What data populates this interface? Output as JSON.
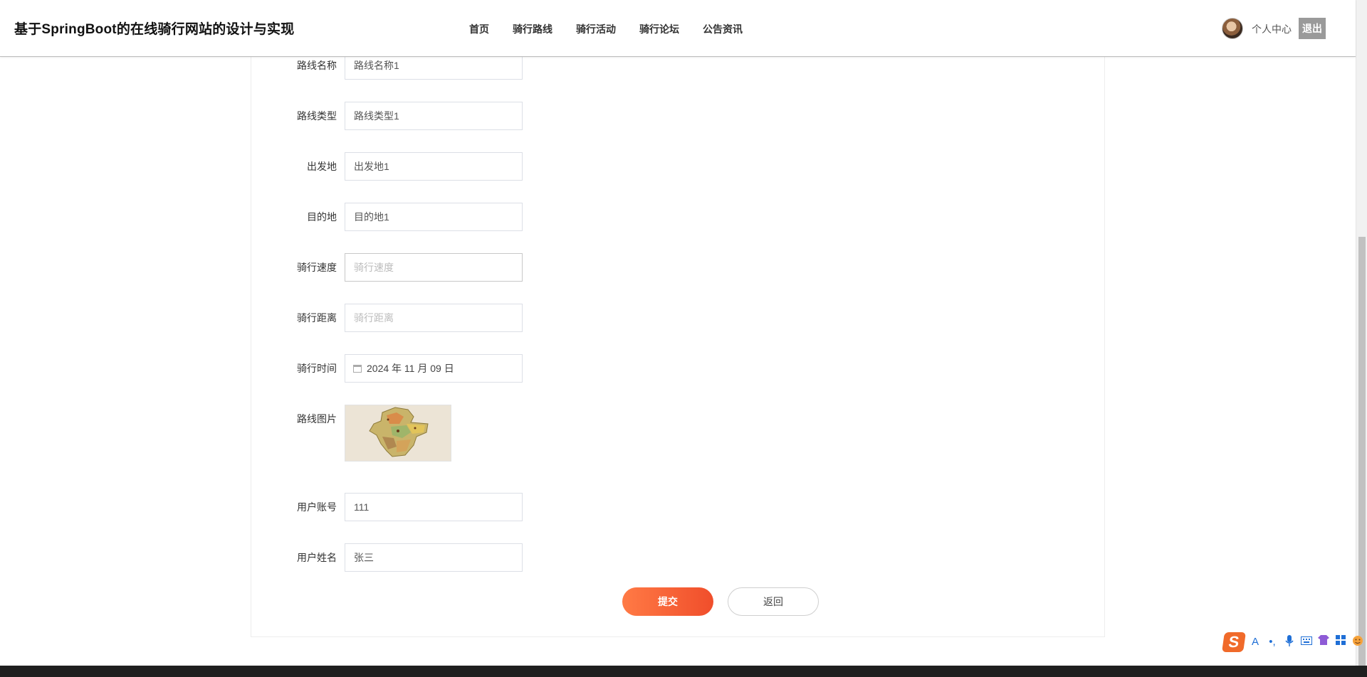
{
  "header": {
    "site_title": "基于SpringBoot的在线骑行网站的设计与实现",
    "nav": [
      {
        "label": "首页"
      },
      {
        "label": "骑行路线"
      },
      {
        "label": "骑行活动"
      },
      {
        "label": "骑行论坛"
      },
      {
        "label": "公告资讯"
      }
    ],
    "profile_label": "个人中心",
    "logout_label": "退出"
  },
  "form": {
    "route_name": {
      "label": "路线名称",
      "value": "路线名称1"
    },
    "route_type": {
      "label": "路线类型",
      "value": "路线类型1"
    },
    "departure": {
      "label": "出发地",
      "value": "出发地1"
    },
    "destination": {
      "label": "目的地",
      "value": "目的地1"
    },
    "speed": {
      "label": "骑行速度",
      "value": "",
      "placeholder": "骑行速度"
    },
    "distance": {
      "label": "骑行距离",
      "value": "",
      "placeholder": "骑行距离"
    },
    "ride_time": {
      "label": "骑行时间",
      "value": "2024 年 11 月 09 日"
    },
    "route_image": {
      "label": "路线图片"
    },
    "user_account": {
      "label": "用户账号",
      "value": "111"
    },
    "user_name": {
      "label": "用户姓名",
      "value": "张三"
    },
    "submit_label": "提交",
    "back_label": "返回"
  },
  "ime": {
    "logo": "S",
    "icons": [
      "letter-a-icon",
      "punctuation-icon",
      "microphone-icon",
      "keyboard-icon",
      "shirt-icon",
      "grid-icon",
      "emoji-icon"
    ]
  },
  "colors": {
    "accent_gradient_start": "#ff7a45",
    "accent_gradient_end": "#f04e2b",
    "logout_bg": "#9a9a9a",
    "footer_bg": "#1f1f1f"
  }
}
